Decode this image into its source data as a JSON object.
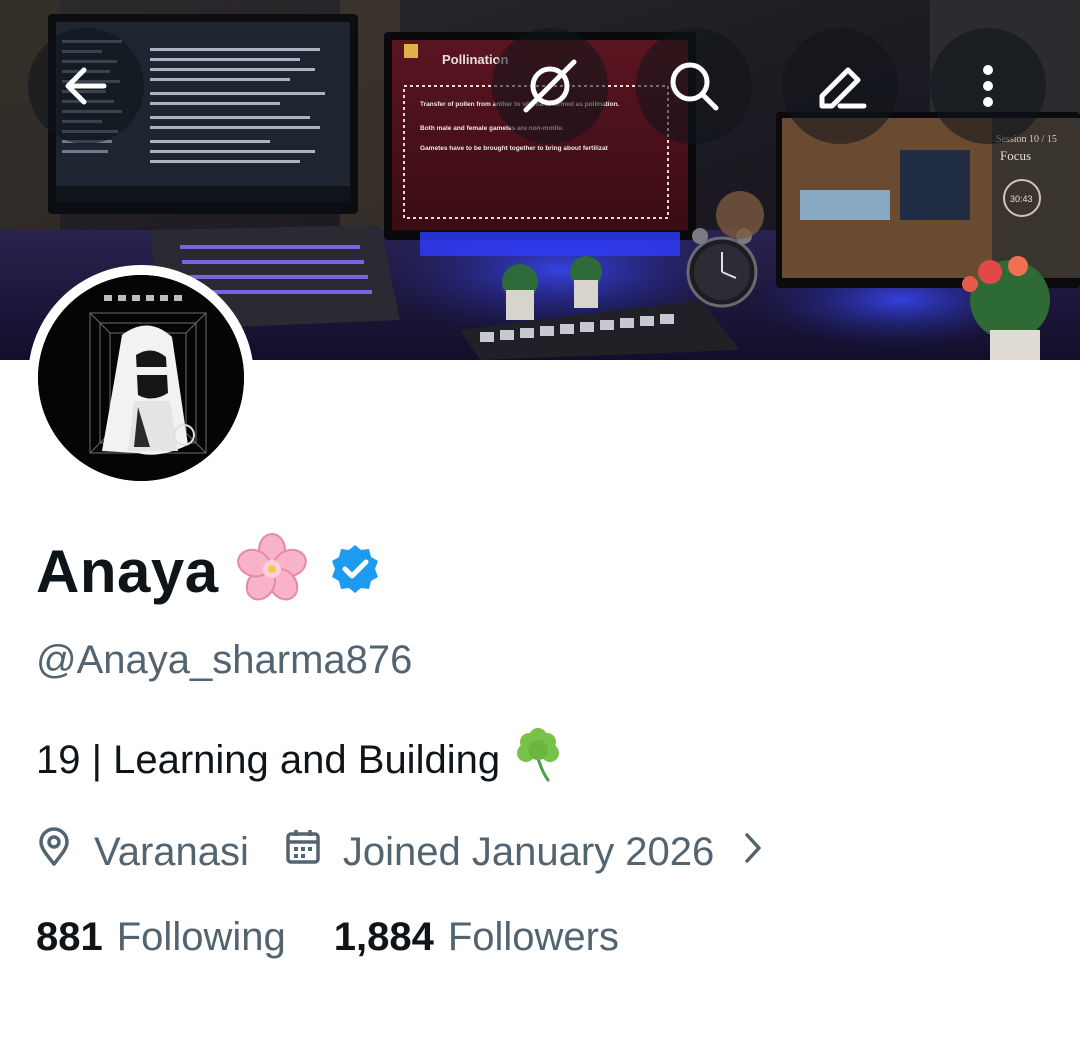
{
  "header": {
    "back_icon": "arrow-left-icon",
    "grok_icon": "grok-icon",
    "search_icon": "search-icon",
    "edit_icon": "edit-icon",
    "more_icon": "more-vertical-icon"
  },
  "banner": {
    "slide_title": "Pollination",
    "slide_points": [
      "Transfer of pollen from anther to stigma is termed as pollination.",
      "Both male and female gametes are non-motile.",
      "Gametes have to be brought together to bring about fertilizat"
    ],
    "timer_label": "Focus",
    "session_label": "Session 10 / 15",
    "timer_value": "30:43"
  },
  "profile": {
    "display_name": "Anaya",
    "name_emoji": "cherry-blossom",
    "verified": true,
    "handle": "@Anaya_sharma876",
    "bio": "19 | Learning and Building",
    "bio_emoji": "shamrock",
    "location": "Varanasi",
    "joined": "Joined January 2026"
  },
  "stats": {
    "following_count": "881",
    "following_label": "Following",
    "followers_count": "1,884",
    "followers_label": "Followers"
  },
  "colors": {
    "primary_text": "#0f1419",
    "secondary_text": "#536471",
    "verified_blue": "#1d9bf0"
  }
}
